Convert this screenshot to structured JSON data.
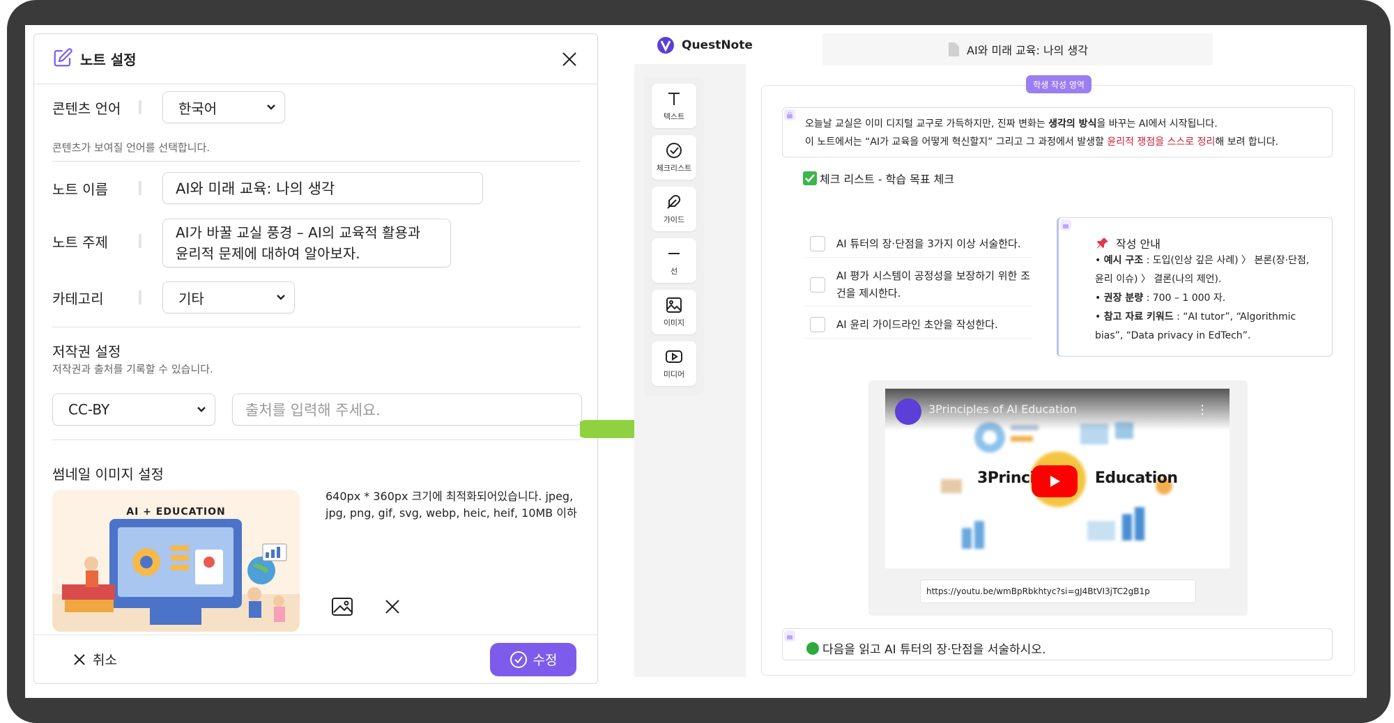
{
  "dialog": {
    "title": "노트 설정",
    "language": {
      "label": "콘텐츠 언어",
      "value": "한국어",
      "hint": "콘텐츠가 보여질 언어를 선택합니다."
    },
    "note_name": {
      "label": "노트 이름",
      "value": "AI와 미래 교육: 나의 생각"
    },
    "note_topic": {
      "label": "노트 주제",
      "value": "AI가 바꿀 교실 풍경 – AI의 교육적 활용과 윤리적 문제에 대하여 알아보자."
    },
    "category": {
      "label": "카테고리",
      "value": "기타"
    },
    "copyright": {
      "title": "저작권 설정",
      "hint": "저작권과 출처를 기록할 수 있습니다.",
      "license": "CC-BY",
      "source_placeholder": "출처를 입력해 주세요."
    },
    "thumbnail": {
      "title": "썸네일 이미지 설정",
      "image_caption": "AI + EDUCATION",
      "info": "640px * 360px 크기에 최적화되어있습니다. jpeg, jpg, png, gif, svg, webp, heic, heif, 10MB 이하"
    },
    "cancel_label": "취소",
    "submit_label": "수정"
  },
  "editor": {
    "brand": "QuestNote",
    "doc_title": "AI와 미래 교육: 나의 생각",
    "student_tag": "학생 작성 영역",
    "tools": [
      "텍스트",
      "체크리스트",
      "가이드",
      "선",
      "이미지",
      "미디어"
    ],
    "intro": {
      "l1a": "오늘날 교실은 이미 디지털 교구로 가득하지만, 진짜 변화는 ",
      "l1b": "생각의 방식",
      "l1c": "을 바꾸는 AI에서 시작됩니다.",
      "l2a": "이 노트에서는 “AI가 교육을 어떻게 혁신할지” 그리고 그 과정에서 발생할 ",
      "l2b": "윤리적 쟁점을 스스로 정리",
      "l2c": "해 보려 합니다."
    },
    "checklist": {
      "title": "체크 리스트 - 학습 목표 체크",
      "items": [
        "AI 튜터의 장·단점을 3가지 이상 서술한다.",
        "AI 평가 시스템이 공정성을 보장하기 위한 조건을 제시한다.",
        "AI 윤리 가이드라인 초안을 작성한다."
      ]
    },
    "guide": {
      "title": "작성 안내",
      "b1_label": "예시 구조",
      "b1_text": " : 도입(인상 깊은 사례) 〉 본론(장·단점, 윤리 이슈) 〉 결론(나의 제언).",
      "b2_label": "권장 분량",
      "b2_text": " : 700 – 1 000 자.",
      "b3_label": "참고 자료 키워드",
      "b3_text": " : “AI tutor”, “Algorithmic bias”, “Data privacy in EdTech”."
    },
    "video": {
      "title": "3Principles of AI Education",
      "center_left": "3Principl",
      "center_right": "Education",
      "url": "https://youtu.be/wmBpRbkhtyc?si=gJ4BtVI3jTC2gB1p"
    },
    "question": "다음을 읽고 AI 튜터의 장·단점을 서술하시오."
  },
  "colors": {
    "accent": "#7d5cec",
    "arrow": "#8ed33f",
    "frame": "#3a3a3a",
    "highlight_red": "#c81e3a"
  }
}
